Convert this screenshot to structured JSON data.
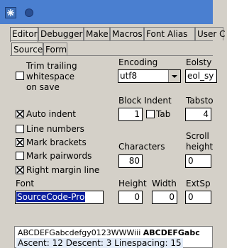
{
  "window": {
    "title": ""
  },
  "tabs": [
    "Editor",
    "Debugger",
    "Make",
    "Macros",
    "Font Alias",
    "User C"
  ],
  "subtabs": [
    "Source",
    "Form"
  ],
  "options": {
    "trim_line1": "Trim trailing",
    "trim_line2": "whitespace",
    "trim_line3": "on save",
    "trim_checked": false,
    "auto_indent": "Auto indent",
    "auto_indent_checked": true,
    "line_numbers": "Line numbers",
    "line_numbers_checked": false,
    "mark_brackets": "Mark brackets",
    "mark_brackets_checked": true,
    "mark_pairwords": "Mark pairwords",
    "mark_pairwords_checked": false,
    "right_margin": "Right margin line",
    "right_margin_checked": true
  },
  "encoding": {
    "label": "Encoding",
    "value": "utf8"
  },
  "eolstyle": {
    "label": "Eolsty",
    "value": "eol_sy"
  },
  "block_indent": {
    "label": "Block Indent",
    "value": "1"
  },
  "tab": {
    "label": "Tab",
    "checked": false
  },
  "tabstop": {
    "label": "Tabsto",
    "value": "4"
  },
  "characters": {
    "label": "Characters",
    "value": "80"
  },
  "scroll": {
    "label1": "Scroll",
    "label2": "height",
    "value": "0"
  },
  "font": {
    "label": "Font",
    "value": "SourceCode-Pro"
  },
  "height": {
    "label": "Height",
    "value": "0"
  },
  "width": {
    "label": "Width",
    "value": "0"
  },
  "extsp": {
    "label": "ExtSp",
    "value": "0"
  },
  "preview": {
    "sample_regular": "ABCDEFGabcdefgy0123WWWiii ",
    "sample_bold": "ABCDEFGabc",
    "metrics": "Ascent: 12 Descent: 3 Linespacing: 15"
  }
}
